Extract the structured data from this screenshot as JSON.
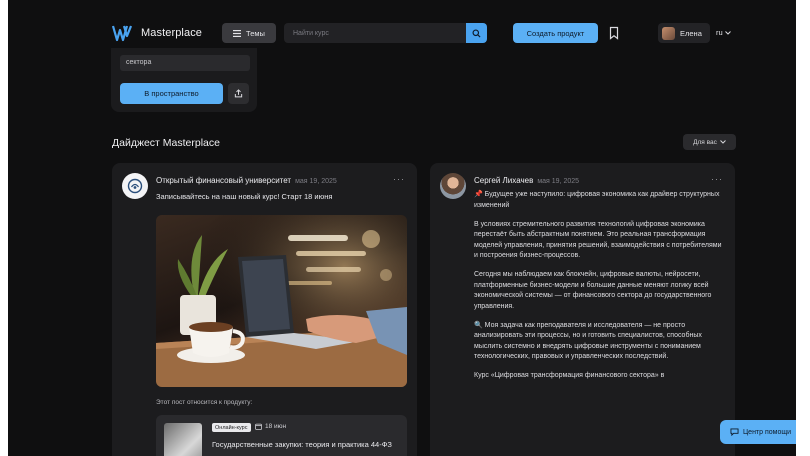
{
  "header": {
    "brand": "Masterplace",
    "themes_label": "Темы",
    "search_placeholder": "Найти курс",
    "create_label": "Создать продукт",
    "user_name": "Елена",
    "lang": "ru"
  },
  "top_card": {
    "field_text": "сектора",
    "space_label": "В пространство"
  },
  "digest": {
    "title": "Дайджест Masterplace",
    "filter_label": "Для вас"
  },
  "posts": [
    {
      "author": "Открытый финансовый университет",
      "date": "мая 19, 2025",
      "lead": "Записывайтесь на наш новый курс! Старт 18 июня",
      "relates": "Этот пост относится к продукту:",
      "product": {
        "badge": "Онлайн-курс",
        "date": "18 июн",
        "title": "Государственные закупки: теория и практика 44-ФЗ"
      }
    },
    {
      "author": "Сергей Лихачев",
      "date": "мая 19, 2025",
      "paragraphs": [
        "📌 Будущее уже наступило: цифровая экономика как драйвер структурных изменений",
        "В условиях стремительного развития технологий цифровая экономика перестаёт быть абстрактным понятием. Это реальная трансформация моделей управления, принятия решений, взаимодействия с потребителями и построения бизнес-процессов.",
        "Сегодня мы наблюдаем как блокчейн, цифровые валюты, нейросети, платформенные бизнес-модели и большие данные меняют логику всей экономической системы — от финансового сектора до государственного управления.",
        "🔍 Моя задача как преподавателя и исследователя — не просто анализировать эти процессы, но и готовить специалистов, способных мыслить системно и внедрять цифровые инструменты с пониманием технологических, правовых и управленческих последствий.",
        "Курс «Цифровая трансформация финансового сектора» в"
      ]
    }
  ],
  "help_label": "Центр помощи",
  "colors": {
    "accent": "#5bb0f5",
    "background": "#0f0f10",
    "card": "#1c1c1e"
  },
  "icons": [
    "logo-icon",
    "menu-icon",
    "search-icon",
    "bookmark-icon",
    "chevron-down-icon",
    "share-icon",
    "more-icon",
    "calendar-icon",
    "chat-icon"
  ]
}
